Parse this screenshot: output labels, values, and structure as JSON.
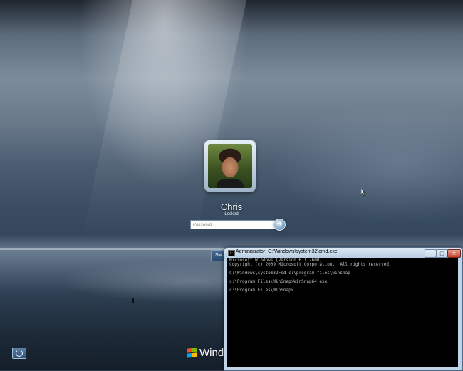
{
  "logon": {
    "user_name": "Chris",
    "status": "Locked",
    "password_placeholder": "Password",
    "go_icon": "arrow-right-icon",
    "switch_user_label": "Sw"
  },
  "ease_of_access": {
    "icon": "ease-of-access-icon"
  },
  "branding": {
    "text": "Windo"
  },
  "cmd": {
    "title": "Administrator: C:\\Windows\\system32\\cmd.exe",
    "buttons": {
      "minimize": "–",
      "maximize": "□",
      "close": "×"
    },
    "lines": [
      "Microsoft Windows [Version 6.1.7600]",
      "Copyright (c) 2009 Microsoft Corporation.  All rights reserved.",
      "",
      "C:\\Windows\\system32>cd c:\\program files\\winsnap",
      "",
      "c:\\Program Files\\WinSnap>WinSnap64.exe",
      "",
      "c:\\Program Files\\WinSnap>"
    ]
  },
  "colors": {
    "console_bg": "#000000",
    "console_text": "#c0c0c0",
    "close_button": "#c0432c"
  }
}
